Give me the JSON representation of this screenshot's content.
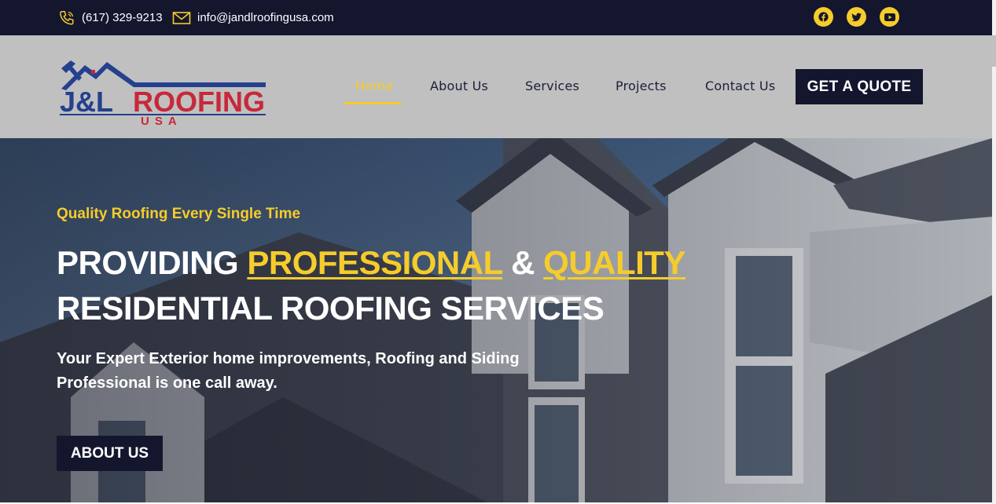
{
  "topbar": {
    "phone": "(617) 329-9213",
    "email": "info@jandlroofingusa.com",
    "social": [
      {
        "icon": "facebook-icon"
      },
      {
        "icon": "twitter-icon"
      },
      {
        "icon": "youtube-icon"
      }
    ]
  },
  "logo": {
    "line1": "J&L ROOFING",
    "line2": "USA"
  },
  "nav": {
    "items": [
      {
        "label": "Home",
        "active": true
      },
      {
        "label": "About Us"
      },
      {
        "label": "Services"
      },
      {
        "label": "Projects"
      },
      {
        "label": "Contact Us"
      }
    ],
    "cta": "GET A QUOTE"
  },
  "hero": {
    "tagline": "Quality Roofing Every Single Time",
    "headline_pre": "PROVIDING ",
    "headline_hl1": "PROFESSIONAL",
    "headline_mid": " & ",
    "headline_hl2": "QUALITY",
    "headline_line2": "RESIDENTIAL ROOFING SERVICES",
    "subtext": "Your Expert Exterior home improvements, Roofing and Siding Professional is one call away.",
    "button": "ABOUT US"
  },
  "colors": {
    "navy": "#14162e",
    "accent_yellow": "#f6cc2b",
    "header_gray": "#c0c0c0",
    "brand_red": "#c8283a",
    "brand_blue": "#24408e"
  }
}
